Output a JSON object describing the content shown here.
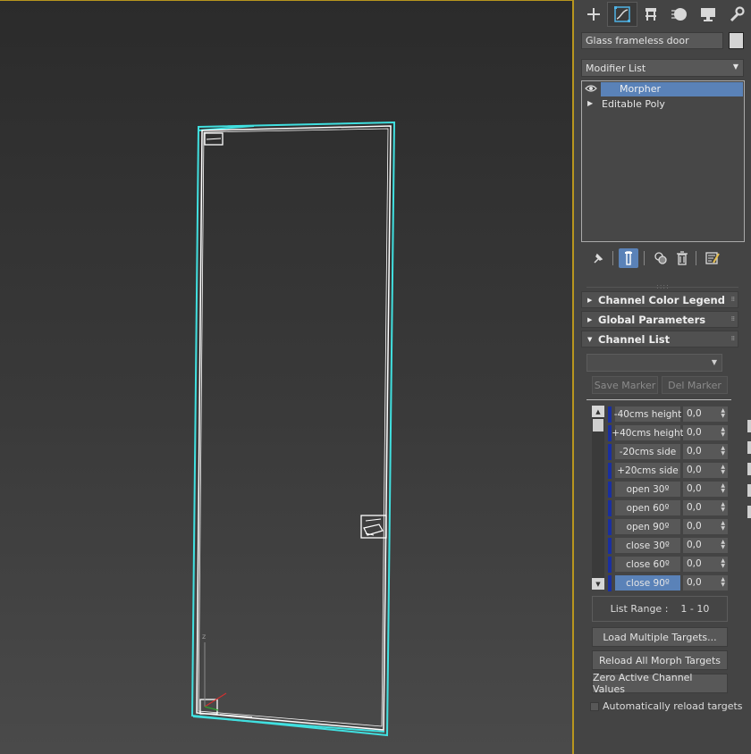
{
  "viewport": {
    "name": "perspective-viewport",
    "axis_label": "z"
  },
  "command_panel": {
    "tabs": [
      {
        "name": "tab-create",
        "icon": "plus-icon"
      },
      {
        "name": "tab-modify",
        "icon": "modify-curve-icon"
      },
      {
        "name": "tab-hierarchy",
        "icon": "hierarchy-icon"
      },
      {
        "name": "tab-motion",
        "icon": "motion-icon"
      },
      {
        "name": "tab-display",
        "icon": "display-monitor-icon"
      },
      {
        "name": "tab-utilities",
        "icon": "wrench-icon"
      }
    ],
    "active_tab": "tab-modify",
    "object_name": "Glass frameless  door",
    "object_color": "#d4d4d4",
    "modifier_list_label": "Modifier List",
    "stack": [
      {
        "label": "Morpher",
        "selected": true
      },
      {
        "label": "Editable Poly",
        "selected": false
      }
    ],
    "rollouts": {
      "channel_color_legend": "Channel Color Legend",
      "global_parameters": "Global Parameters",
      "channel_list": "Channel List"
    },
    "markers": {
      "save_marker": "Save Marker",
      "del_marker": "Del Marker"
    },
    "channels": [
      {
        "name": "-40cms height",
        "value": "0,0"
      },
      {
        "name": "+40cms height",
        "value": "0,0"
      },
      {
        "name": "-20cms side",
        "value": "0,0"
      },
      {
        "name": "+20cms side",
        "value": "0,0"
      },
      {
        "name": "open 30º",
        "value": "0,0"
      },
      {
        "name": "open 60º",
        "value": "0,0"
      },
      {
        "name": "open 90º",
        "value": "0,0"
      },
      {
        "name": "close 30º",
        "value": "0,0"
      },
      {
        "name": "close 60º",
        "value": "0,0"
      },
      {
        "name": "close 90º",
        "value": "0,0",
        "selected": true
      }
    ],
    "list_range_label": "List Range :",
    "list_range_value": "1 - 10",
    "buttons": {
      "load_multiple": "Load Multiple Targets...",
      "reload_all": "Reload All Morph Targets",
      "zero_active": "Zero Active Channel Values"
    },
    "auto_reload_label": "Automatically reload targets",
    "auto_reload_checked": false,
    "colors": {
      "selection": "#5a82b8",
      "viewport_border": "#b8961e",
      "wireframe": "#40e0e0"
    }
  }
}
